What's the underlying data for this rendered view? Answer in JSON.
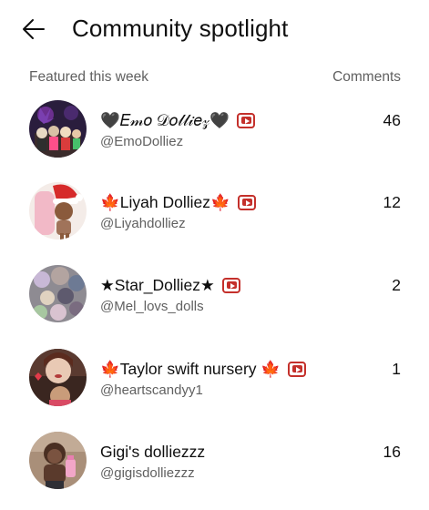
{
  "header": {
    "title": "Community spotlight",
    "back_icon": "arrow-left-icon"
  },
  "list_headers": {
    "left": "Featured this week",
    "right": "Comments"
  },
  "badge_icon": "youtube-icon",
  "creators": [
    {
      "name": "🖤𝐸𝓂𝑜 𝒟𝑜𝓁𝓁𝒾𝑒𝓏🖤",
      "handle": "@EmoDolliez",
      "comments": "46"
    },
    {
      "name": "🍁Liyah Dolliez🍁",
      "handle": "@Liyahdolliez",
      "comments": "12"
    },
    {
      "name": "★Star_Dolliez★",
      "handle": "@Mel_lovs_dolls",
      "comments": "2"
    },
    {
      "name": "🍁Taylor swift nursery 🍁",
      "handle": "@heartscandyy1",
      "comments": "1"
    },
    {
      "name": "Gigi's dolliezzz",
      "handle": "@gigisdolliezzz",
      "comments": "16"
    }
  ]
}
